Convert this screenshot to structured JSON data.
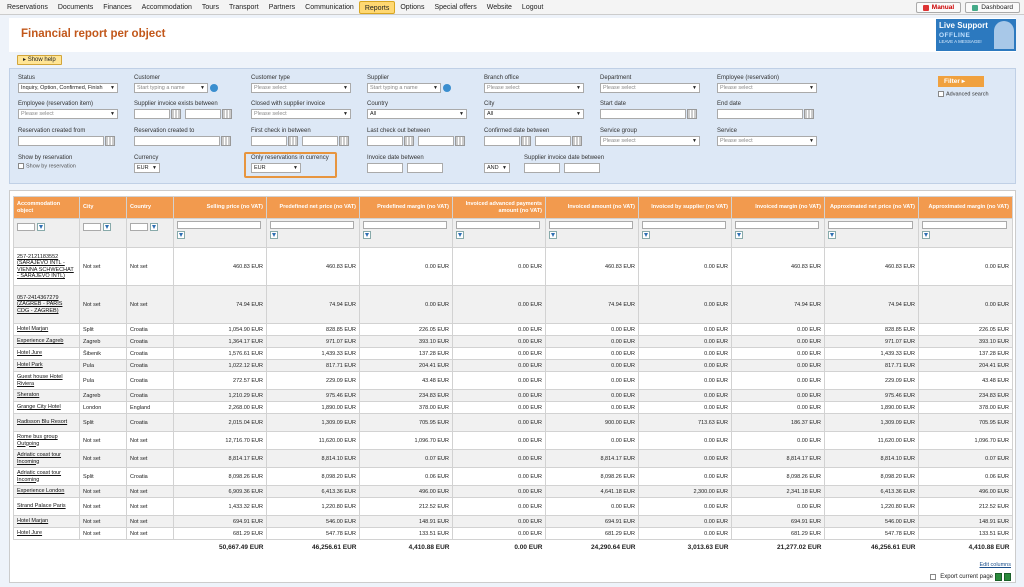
{
  "nav": {
    "items": [
      "Reservations",
      "Documents",
      "Finances",
      "Accommodation",
      "Tours",
      "Transport",
      "Partners",
      "Communication",
      "Reports",
      "Options",
      "Special offers",
      "Website",
      "Logout"
    ],
    "active": "Reports",
    "manual": "Manual",
    "dashboard": "Dashboard"
  },
  "header": {
    "title": "Financial report per object",
    "live_support": {
      "line1": "Live Support",
      "line2": "OFFLINE",
      "line3": "LEAVE A MESSAGE!"
    }
  },
  "show_help": "Show help",
  "filters": {
    "status": {
      "label": "Status",
      "value": "Inquiry, Option, Confirmed, Finish"
    },
    "customer": {
      "label": "Customer",
      "placeholder": "Start typing a name"
    },
    "customer_type": {
      "label": "Customer type",
      "value": "Please select"
    },
    "supplier": {
      "label": "Supplier",
      "placeholder": "Start typing a name"
    },
    "branch_office": {
      "label": "Branch office",
      "value": "Please select"
    },
    "department": {
      "label": "Department",
      "value": "Please select"
    },
    "employee_reservation": {
      "label": "Employee (reservation)",
      "value": "Please select"
    },
    "employee_reservation_item": {
      "label": "Employee (reservation item)",
      "value": "Please select"
    },
    "supplier_invoice_between": {
      "label": "Supplier invoice exists between"
    },
    "closed_with_supplier": {
      "label": "Closed with supplier invoice",
      "value": "Please select"
    },
    "country": {
      "label": "Country",
      "value": "All"
    },
    "city": {
      "label": "City",
      "value": "All"
    },
    "start_date": {
      "label": "Start date"
    },
    "end_date": {
      "label": "End date"
    },
    "reservation_created_from": {
      "label": "Reservation created from"
    },
    "reservation_created_to": {
      "label": "Reservation created to"
    },
    "first_checkin": {
      "label": "First check in between"
    },
    "last_checkout": {
      "label": "Last check out between"
    },
    "confirmed_date": {
      "label": "Confirmed date between"
    },
    "service_group": {
      "label": "Service group",
      "value": "Please select"
    },
    "service": {
      "label": "Service",
      "value": "Please select"
    },
    "show_by_reservation": {
      "label": "Show by reservation",
      "checkbox": "Show by reservation"
    },
    "currency": {
      "label": "Currency",
      "value": "EUR"
    },
    "only_res_currency": {
      "label": "Only reservations in currency",
      "value": "EUR"
    },
    "invoice_date": {
      "label": "Invoice date between"
    },
    "and_or": {
      "value": "AND"
    },
    "supplier_invoice_date": {
      "label": "Supplier invoice date between"
    },
    "filter_button": "Filter",
    "advanced_search": "Advanced search"
  },
  "table": {
    "headers": [
      "Accommodation object",
      "City",
      "Country",
      "Selling price (no VAT)",
      "Predefined net price (no VAT)",
      "Predefined margin (no VAT)",
      "Invoiced advanced payments amount (no VAT)",
      "Invoiced amount (no VAT)",
      "Invoiced by supplier (no VAT)",
      "Invoiced margin (no VAT)",
      "Approximated net price (no VAT)",
      "Approximated margin (no VAT)"
    ],
    "rows": [
      [
        "257-2121183552 (SARAJEVO INTL - VIENNA SCHWECHAT - SARAJEVO INTL)",
        "Not set",
        "Not set",
        "460.83 EUR",
        "460.83 EUR",
        "0.00 EUR",
        "0.00 EUR",
        "460.83 EUR",
        "0.00 EUR",
        "460.83 EUR",
        "460.83 EUR",
        "0.00 EUR"
      ],
      [
        "057-2414367279 (ZAGREB - PARIS CDG - ZAGREB)",
        "Not set",
        "Not set",
        "74.94 EUR",
        "74.94 EUR",
        "0.00 EUR",
        "0.00 EUR",
        "74.94 EUR",
        "0.00 EUR",
        "74.94 EUR",
        "74.94 EUR",
        "0.00 EUR"
      ],
      [
        "Hotel Marjan",
        "Split",
        "Croatia",
        "1,054.90 EUR",
        "828.85 EUR",
        "226.05 EUR",
        "0.00 EUR",
        "0.00 EUR",
        "0.00 EUR",
        "0.00 EUR",
        "828.85 EUR",
        "226.05 EUR"
      ],
      [
        "Experience Zagreb",
        "Zagreb",
        "Croatia",
        "1,364.17 EUR",
        "971.07 EUR",
        "393.10 EUR",
        "0.00 EUR",
        "0.00 EUR",
        "0.00 EUR",
        "0.00 EUR",
        "971.07 EUR",
        "393.10 EUR"
      ],
      [
        "Hotel Jure",
        "Šibenik",
        "Croatia",
        "1,576.61 EUR",
        "1,439.33 EUR",
        "137.28 EUR",
        "0.00 EUR",
        "0.00 EUR",
        "0.00 EUR",
        "0.00 EUR",
        "1,439.33 EUR",
        "137.28 EUR"
      ],
      [
        "Hotel Park",
        "Pula",
        "Croatia",
        "1,022.12 EUR",
        "817.71 EUR",
        "204.41 EUR",
        "0.00 EUR",
        "0.00 EUR",
        "0.00 EUR",
        "0.00 EUR",
        "817.71 EUR",
        "204.41 EUR"
      ],
      [
        "Guest house Hotel Riviera",
        "Pula",
        "Croatia",
        "272.57 EUR",
        "229.09 EUR",
        "43.48 EUR",
        "0.00 EUR",
        "0.00 EUR",
        "0.00 EUR",
        "0.00 EUR",
        "229.09 EUR",
        "43.48 EUR"
      ],
      [
        "Sheraton",
        "Zagreb",
        "Croatia",
        "1,210.29 EUR",
        "975.46 EUR",
        "234.83 EUR",
        "0.00 EUR",
        "0.00 EUR",
        "0.00 EUR",
        "0.00 EUR",
        "975.46 EUR",
        "234.83 EUR"
      ],
      [
        "Grange City Hotel",
        "London",
        "England",
        "2,268.00 EUR",
        "1,890.00 EUR",
        "378.00 EUR",
        "0.00 EUR",
        "0.00 EUR",
        "0.00 EUR",
        "0.00 EUR",
        "1,890.00 EUR",
        "378.00 EUR"
      ],
      [
        "Radisson Blu Resort",
        "Split",
        "Croatia",
        "2,015.04 EUR",
        "1,309.09 EUR",
        "705.95 EUR",
        "0.00 EUR",
        "900.00 EUR",
        "713.63 EUR",
        "186.37 EUR",
        "1,309.09 EUR",
        "705.95 EUR"
      ],
      [
        "Rome bus group Outgoing",
        "Not set",
        "Not set",
        "12,716.70 EUR",
        "11,620.00 EUR",
        "1,096.70 EUR",
        "0.00 EUR",
        "0.00 EUR",
        "0.00 EUR",
        "0.00 EUR",
        "11,620.00 EUR",
        "1,096.70 EUR"
      ],
      [
        "Adriatic coast tour Incoming",
        "Not set",
        "Not set",
        "8,814.17 EUR",
        "8,814.10 EUR",
        "0.07 EUR",
        "0.00 EUR",
        "8,814.17 EUR",
        "0.00 EUR",
        "8,814.17 EUR",
        "8,814.10 EUR",
        "0.07 EUR"
      ],
      [
        "Adriatic coast tour Incoming",
        "Split",
        "Croatia",
        "8,098.26 EUR",
        "8,098.20 EUR",
        "0.06 EUR",
        "0.00 EUR",
        "8,098.26 EUR",
        "0.00 EUR",
        "8,098.26 EUR",
        "8,098.20 EUR",
        "0.06 EUR"
      ],
      [
        "Experience London",
        "Not set",
        "Not set",
        "6,909.36 EUR",
        "6,413.36 EUR",
        "496.00 EUR",
        "0.00 EUR",
        "4,641.18 EUR",
        "2,300.00 EUR",
        "2,341.18 EUR",
        "6,413.36 EUR",
        "496.00 EUR"
      ],
      [
        "Strand Palace Paris",
        "Not set",
        "Not set",
        "1,433.32 EUR",
        "1,220.80 EUR",
        "212.52 EUR",
        "0.00 EUR",
        "0.00 EUR",
        "0.00 EUR",
        "0.00 EUR",
        "1,220.80 EUR",
        "212.52 EUR"
      ],
      [
        "Hotel Marjan",
        "Not set",
        "Not set",
        "694.91 EUR",
        "546.00 EUR",
        "148.91 EUR",
        "0.00 EUR",
        "694.91 EUR",
        "0.00 EUR",
        "694.91 EUR",
        "546.00 EUR",
        "148.91 EUR"
      ],
      [
        "Hotel Jure",
        "Not set",
        "Not set",
        "681.29 EUR",
        "547.78 EUR",
        "133.51 EUR",
        "0.00 EUR",
        "681.29 EUR",
        "0.00 EUR",
        "681.29 EUR",
        "547.78 EUR",
        "133.51 EUR"
      ]
    ],
    "totals": [
      "",
      "",
      "",
      "50,667.49 EUR",
      "46,256.61 EUR",
      "4,410.88 EUR",
      "0.00 EUR",
      "24,290.64 EUR",
      "3,013.63 EUR",
      "21,277.02 EUR",
      "46,256.61 EUR",
      "4,410.88 EUR"
    ],
    "edit_columns": "Edit columns",
    "export_current_page": "Export current page"
  },
  "colors": {
    "accent": "#f29a4e",
    "title": "#c2571a",
    "highlight": "#e7953f"
  }
}
